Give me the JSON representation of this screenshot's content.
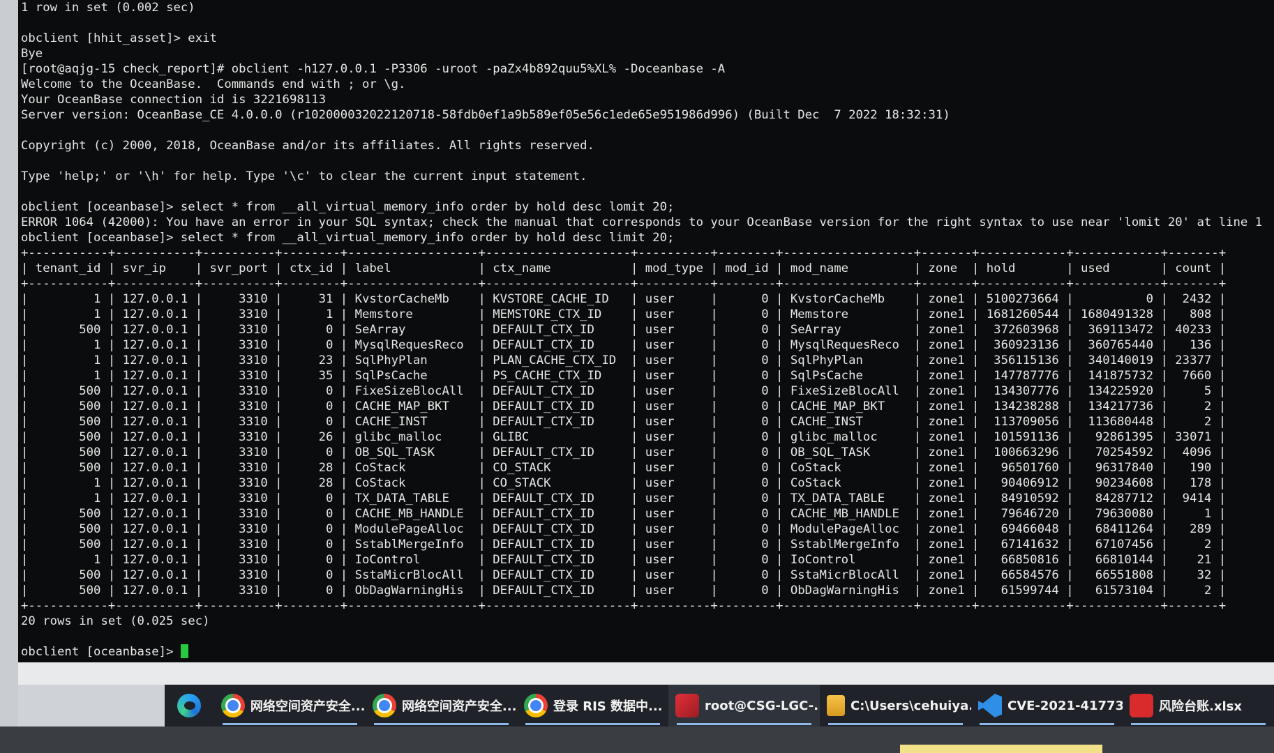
{
  "terminal": {
    "lines": [
      "1 row in set (0.002 sec)",
      "",
      "obclient [hhit_asset]> exit",
      "Bye",
      "[root@aqjg-15 check_report]# obclient -h127.0.0.1 -P3306 -uroot -paZx4b892quu5%XL% -Doceanbase -A",
      "Welcome to the OceanBase.  Commands end with ; or \\g.",
      "Your OceanBase connection id is 3221698113",
      "Server version: OceanBase_CE 4.0.0.0 (r102000032022120718-58fdb0ef1a9b589ef05e56c1ede65e951986d996) (Built Dec  7 2022 18:32:31)",
      "",
      "Copyright (c) 2000, 2018, OceanBase and/or its affiliates. All rights reserved.",
      "",
      "Type 'help;' or '\\h' for help. Type '\\c' to clear the current input statement.",
      "",
      "obclient [oceanbase]> select * from __all_virtual_memory_info order by hold desc lomit 20;",
      "ERROR 1064 (42000): You have an error in your SQL syntax; check the manual that corresponds to your OceanBase version for the right syntax to use near 'lomit 20' at line 1",
      "obclient [oceanbase]> select * from __all_virtual_memory_info order by hold desc limit 20;",
      "+-----------+-----------+----------+--------+------------------+--------------------+----------+--------+------------------+-------+------------+------------+-------+",
      "| tenant_id | svr_ip    | svr_port | ctx_id | label            | ctx_name           | mod_type | mod_id | mod_name         | zone  | hold       | used       | count |",
      "+-----------+-----------+----------+--------+------------------+--------------------+----------+--------+------------------+-------+------------+------------+-------+",
      "|         1 | 127.0.0.1 |     3310 |     31 | KvstorCacheMb    | KVSTORE_CACHE_ID   | user     |      0 | KvstorCacheMb    | zone1 | 5100273664 |          0 |  2432 |",
      "|         1 | 127.0.0.1 |     3310 |      1 | Memstore         | MEMSTORE_CTX_ID    | user     |      0 | Memstore         | zone1 | 1681260544 | 1680491328 |   808 |",
      "|       500 | 127.0.0.1 |     3310 |      0 | SeArray          | DEFAULT_CTX_ID     | user     |      0 | SeArray          | zone1 |  372603968 |  369113472 | 40233 |",
      "|         1 | 127.0.0.1 |     3310 |      0 | MysqlRequesReco  | DEFAULT_CTX_ID     | user     |      0 | MysqlRequesReco  | zone1 |  360923136 |  360765440 |   136 |",
      "|         1 | 127.0.0.1 |     3310 |     23 | SqlPhyPlan       | PLAN_CACHE_CTX_ID  | user     |      0 | SqlPhyPlan       | zone1 |  356115136 |  340140019 | 23377 |",
      "|         1 | 127.0.0.1 |     3310 |     35 | SqlPsCache       | PS_CACHE_CTX_ID    | user     |      0 | SqlPsCache       | zone1 |  147787776 |  141875732 |  7660 |",
      "|       500 | 127.0.0.1 |     3310 |      0 | FixeSizeBlocAll  | DEFAULT_CTX_ID     | user     |      0 | FixeSizeBlocAll  | zone1 |  134307776 |  134225920 |     5 |",
      "|       500 | 127.0.0.1 |     3310 |      0 | CACHE_MAP_BKT    | DEFAULT_CTX_ID     | user     |      0 | CACHE_MAP_BKT    | zone1 |  134238288 |  134217736 |     2 |",
      "|       500 | 127.0.0.1 |     3310 |      0 | CACHE_INST       | DEFAULT_CTX_ID     | user     |      0 | CACHE_INST       | zone1 |  113709056 |  113680448 |     2 |",
      "|       500 | 127.0.0.1 |     3310 |     26 | glibc_malloc     | GLIBC              | user     |      0 | glibc_malloc     | zone1 |  101591136 |   92861395 | 33071 |",
      "|       500 | 127.0.0.1 |     3310 |      0 | OB_SQL_TASK      | DEFAULT_CTX_ID     | user     |      0 | OB_SQL_TASK      | zone1 |  100663296 |   70254592 |  4096 |",
      "|       500 | 127.0.0.1 |     3310 |     28 | CoStack          | CO_STACK           | user     |      0 | CoStack          | zone1 |   96501760 |   96317840 |   190 |",
      "|         1 | 127.0.0.1 |     3310 |     28 | CoStack          | CO_STACK           | user     |      0 | CoStack          | zone1 |   90406912 |   90234608 |   178 |",
      "|         1 | 127.0.0.1 |     3310 |      0 | TX_DATA_TABLE    | DEFAULT_CTX_ID     | user     |      0 | TX_DATA_TABLE    | zone1 |   84910592 |   84287712 |  9414 |",
      "|       500 | 127.0.0.1 |     3310 |      0 | CACHE_MB_HANDLE  | DEFAULT_CTX_ID     | user     |      0 | CACHE_MB_HANDLE  | zone1 |   79646720 |   79630080 |     1 |",
      "|       500 | 127.0.0.1 |     3310 |      0 | ModulePageAlloc  | DEFAULT_CTX_ID     | user     |      0 | ModulePageAlloc  | zone1 |   69466048 |   68411264 |   289 |",
      "|       500 | 127.0.0.1 |     3310 |      0 | SstablMergeInfo  | DEFAULT_CTX_ID     | user     |      0 | SstablMergeInfo  | zone1 |   67141632 |   67107456 |     2 |",
      "|         1 | 127.0.0.1 |     3310 |      0 | IoControl        | DEFAULT_CTX_ID     | user     |      0 | IoControl        | zone1 |   66850816 |   66810144 |    21 |",
      "|       500 | 127.0.0.1 |     3310 |      0 | SstaMicrBlocAll  | DEFAULT_CTX_ID     | user     |      0 | SstaMicrBlocAll  | zone1 |   66584576 |   66551808 |    32 |",
      "|       500 | 127.0.0.1 |     3310 |      0 | ObDagWarningHis  | DEFAULT_CTX_ID     | user     |      0 | ObDagWarningHis  | zone1 |   61599744 |   61573104 |     2 |",
      "+-----------+-----------+----------+--------+------------------+--------------------+----------+--------+------------------+-------+------------+------------+-------+",
      "20 rows in set (0.025 sec)",
      ""
    ],
    "prompt": "obclient [oceanbase]> "
  },
  "taskbar": {
    "items": [
      {
        "label": "网络空间资产安全...",
        "icon": "chrome-icon"
      },
      {
        "label": "网络空间资产安全...",
        "icon": "chrome-icon"
      },
      {
        "label": "登录 RIS 数据中...",
        "icon": "chrome-icon"
      },
      {
        "label": "root@CSG-LGC-...",
        "icon": "putty-icon"
      },
      {
        "label": "C:\\Users\\cehuiya...",
        "icon": "folder-icon"
      },
      {
        "label": "CVE-2021-41773...",
        "icon": "vscode-icon"
      },
      {
        "label": "风险台账.xlsx",
        "icon": "wps-icon"
      }
    ]
  },
  "colors": {
    "terminal_bg": "#0b0c0d",
    "terminal_fg": "#e6e6e6",
    "cursor": "#27c93f",
    "taskbar_bg": "#1f2228"
  }
}
